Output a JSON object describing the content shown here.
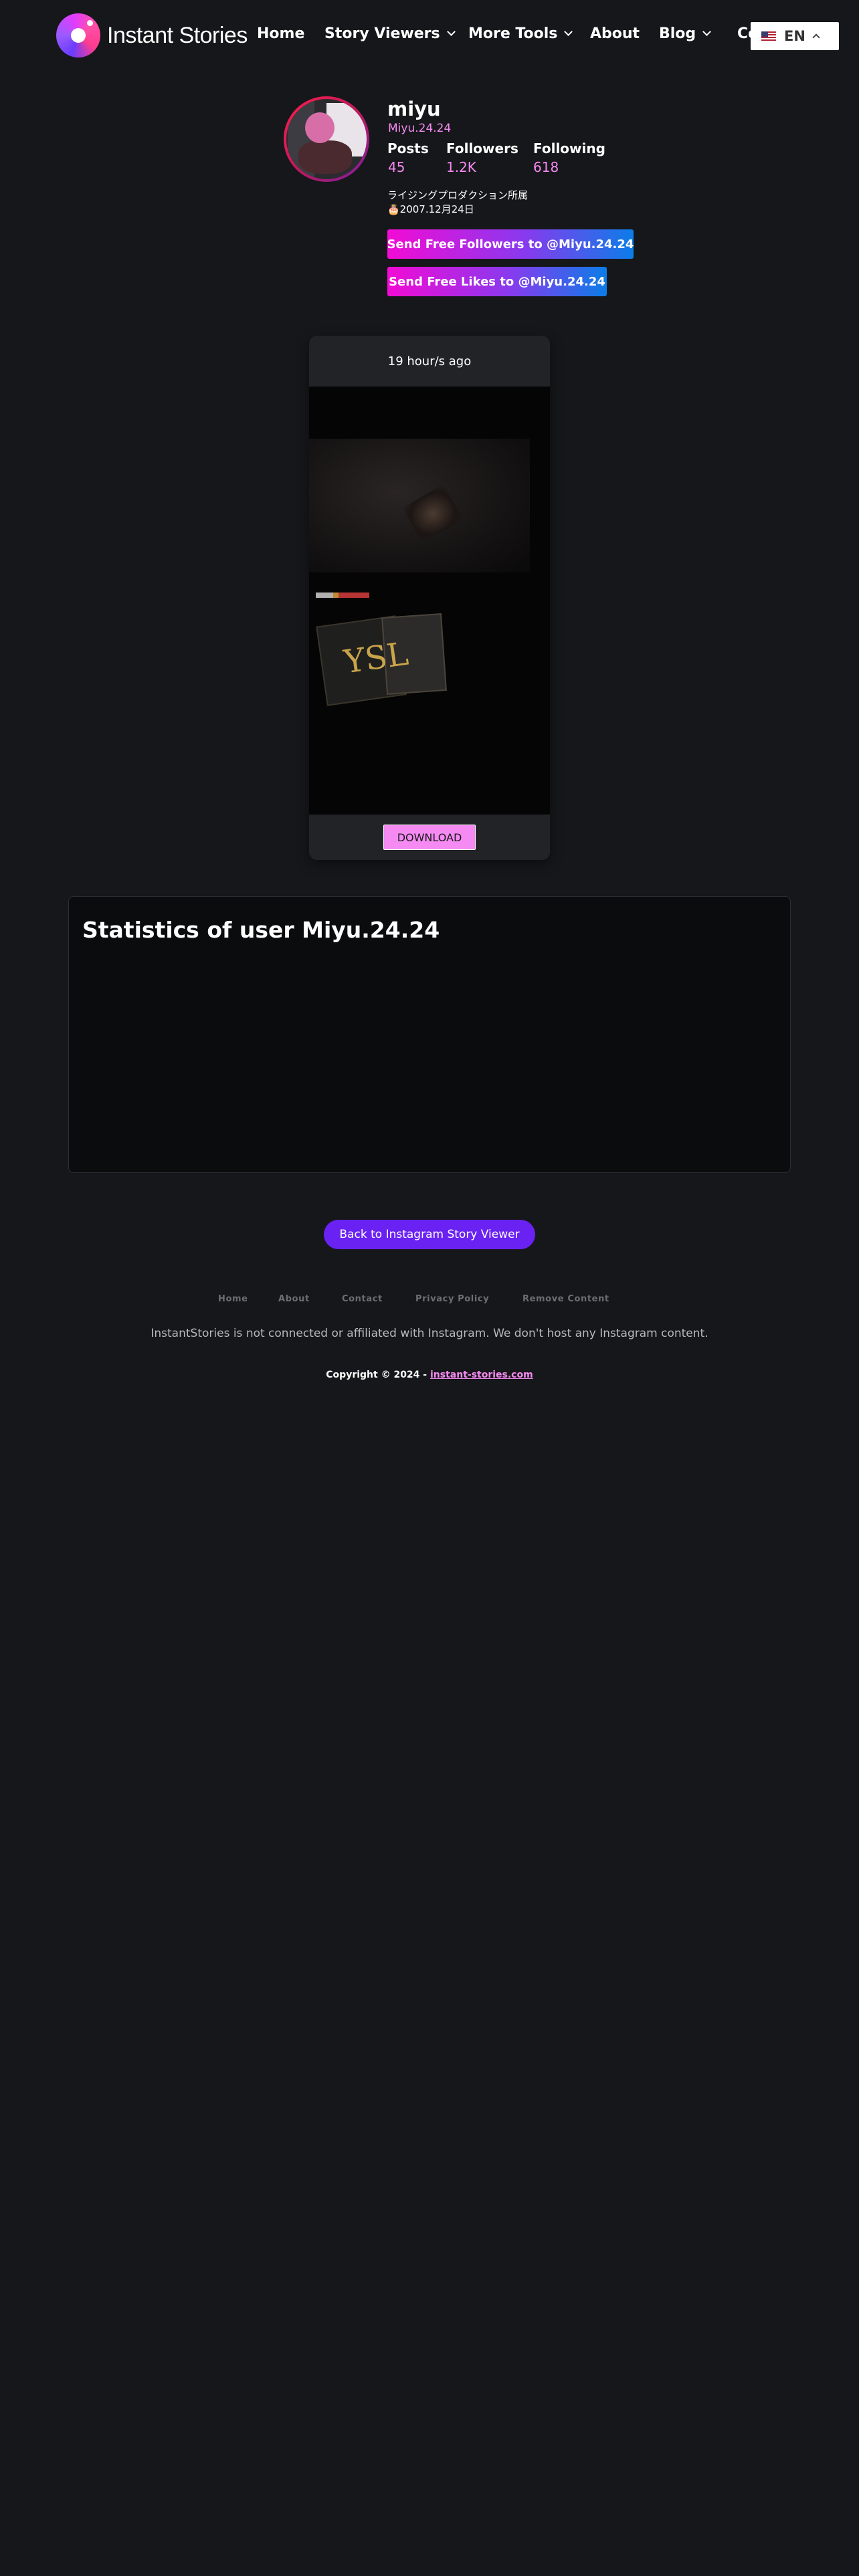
{
  "header": {
    "logo_text": "Instant Stories",
    "nav": [
      {
        "label": "Home"
      },
      {
        "label": "Story Viewers"
      },
      {
        "label": "More Tools"
      },
      {
        "label": "About"
      },
      {
        "label": "Blog"
      },
      {
        "label": "Co"
      }
    ],
    "language": "EN"
  },
  "profile": {
    "name": "miyu",
    "username": "Miyu.24.24",
    "stats": [
      {
        "label": "Posts",
        "value": "45"
      },
      {
        "label": "Followers",
        "value": "1.2K"
      },
      {
        "label": "Following",
        "value": "618"
      }
    ],
    "bio": [
      "ライジングプロダクション所属",
      "🎂2007.12月24日"
    ],
    "followers_button": "Send Free Followers to @Miyu.24.24",
    "likes_button": "Send Free Likes to @Miyu.24.24"
  },
  "story": {
    "time": "19 hour/s ago",
    "media_text": "YSL",
    "download_label": "DOWNLOAD"
  },
  "stats_section": {
    "title": "Statistics of user Miyu.24.24"
  },
  "back_button": "Back to Instagram Story Viewer",
  "footer": {
    "links": [
      "Home",
      "About",
      "Contact",
      "Privacy Policy",
      "Remove Content"
    ],
    "disclaimer": "InstantStories is not connected or affiliated with Instagram. We don't host any Instagram content.",
    "copyright_prefix": "Copyright © 2024 -",
    "copyright_link": "instant-stories.com"
  },
  "colors": {
    "background": "#16171a",
    "accent_pink": "#f58af2",
    "accent_purple": "#6a22f2"
  }
}
